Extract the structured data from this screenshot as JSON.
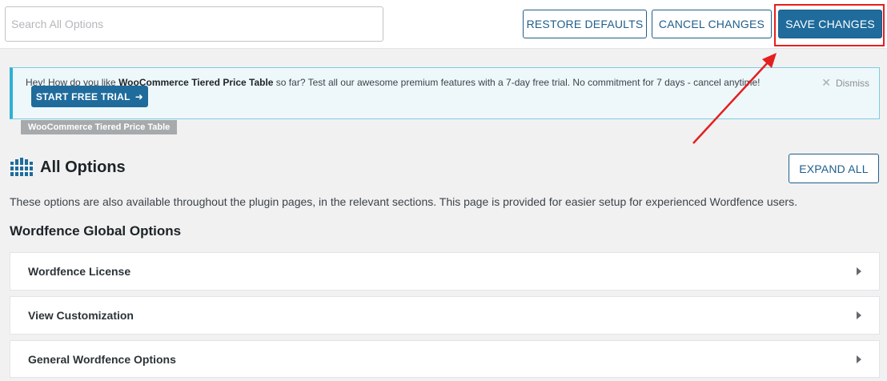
{
  "toolbar": {
    "search_placeholder": "Search All Options",
    "restore_label": "RESTORE DEFAULTS",
    "cancel_label": "CANCEL CHANGES",
    "save_label": "SAVE CHANGES"
  },
  "notice": {
    "text_prefix": "Hey! How do you like ",
    "text_bold": "WooCommerce Tiered Price Table",
    "text_suffix": " so far? Test all our awesome premium features with a 7-day free trial. No commitment for 7 days - cancel anytime!",
    "trial_button_label": "START FREE TRIAL",
    "trial_button_arrow": "➜",
    "dismiss_label": "Dismiss",
    "plugin_tag": "WooCommerce Tiered Price Table"
  },
  "heading": {
    "title": "All Options",
    "expand_label": "EXPAND ALL",
    "description": "These options are also available throughout the plugin pages, in the relevant sections. This page is provided for easier setup for experienced Wordfence users."
  },
  "section": {
    "title": "Wordfence Global Options",
    "panels": [
      {
        "label": "Wordfence License"
      },
      {
        "label": "View Customization"
      },
      {
        "label": "General Wordfence Options"
      }
    ]
  },
  "colors": {
    "accent": "#1f6b9c",
    "highlight": "#e41f1f",
    "notice_border": "#2fb1d3"
  },
  "icons": {
    "heading": "wordfence-logo-icon",
    "dismiss": "close-icon",
    "panel": "caret-right-icon"
  }
}
